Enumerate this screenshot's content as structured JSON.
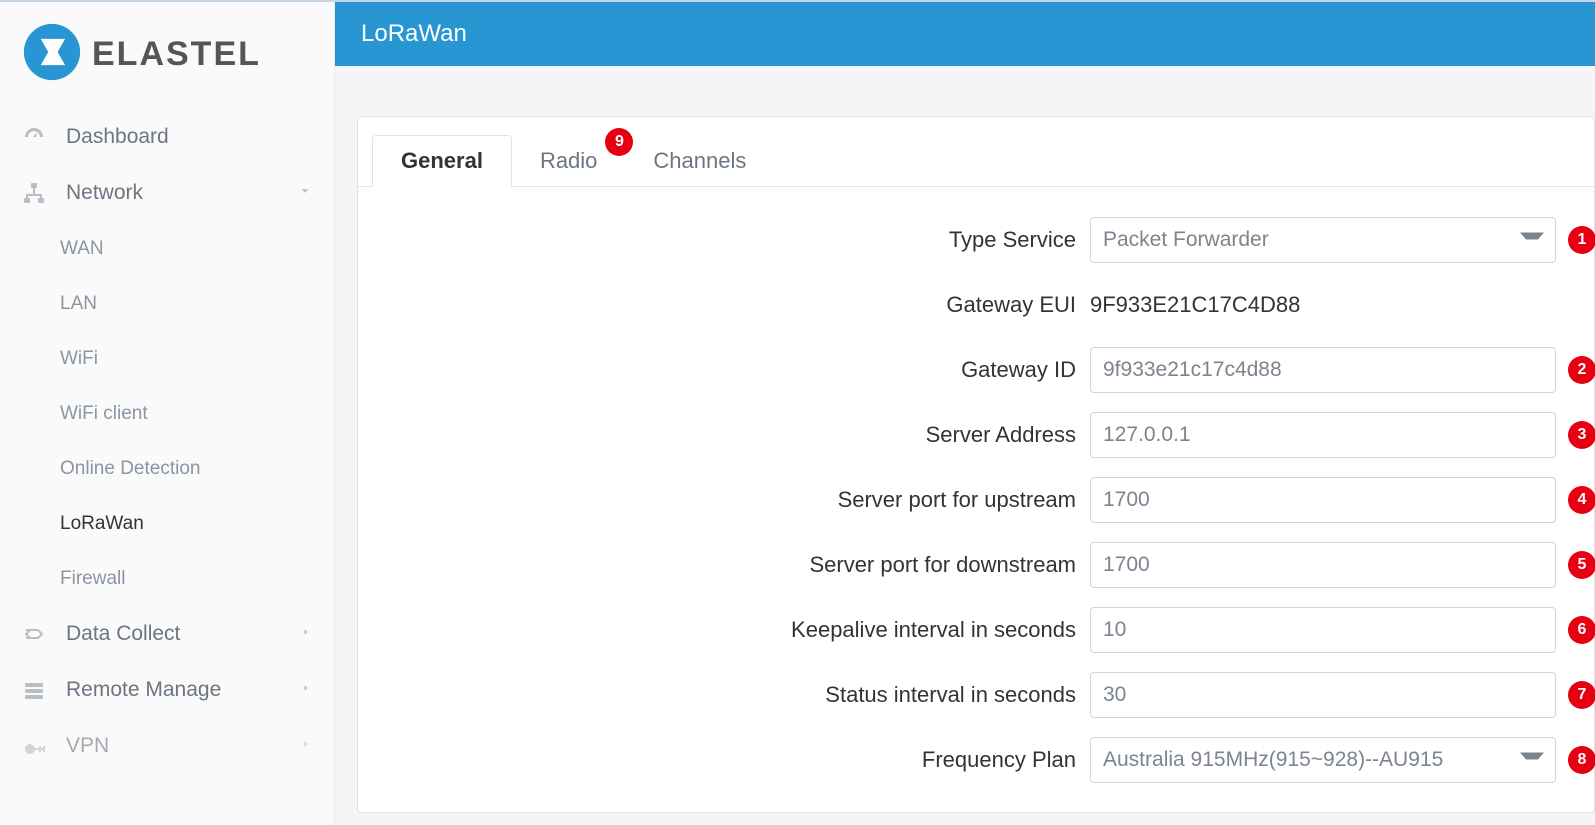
{
  "brand": "ELASTEL",
  "header": {
    "title": "LoRaWan"
  },
  "sidebar": {
    "items": [
      {
        "label": "Dashboard",
        "icon": "dashboard"
      },
      {
        "label": "Network",
        "icon": "network",
        "expanded": true,
        "children": [
          {
            "label": "WAN"
          },
          {
            "label": "LAN"
          },
          {
            "label": "WiFi"
          },
          {
            "label": "WiFi client"
          },
          {
            "label": "Online Detection"
          },
          {
            "label": "LoRaWan",
            "active": true
          },
          {
            "label": "Firewall"
          }
        ]
      },
      {
        "label": "Data Collect",
        "icon": "datacollect"
      },
      {
        "label": "Remote Manage",
        "icon": "remotemanage"
      },
      {
        "label": "VPN",
        "icon": "vpn"
      }
    ]
  },
  "tabs": [
    {
      "label": "General",
      "active": true
    },
    {
      "label": "Radio",
      "badge": "9"
    },
    {
      "label": "Channels"
    }
  ],
  "form": {
    "type_service": {
      "label": "Type Service",
      "value": "Packet Forwarder",
      "annotation": "1"
    },
    "gateway_eui": {
      "label": "Gateway EUI",
      "value": "9F933E21C17C4D88"
    },
    "gateway_id": {
      "label": "Gateway ID",
      "value": "9f933e21c17c4d88",
      "annotation": "2"
    },
    "server_address": {
      "label": "Server Address",
      "value": "127.0.0.1",
      "annotation": "3"
    },
    "port_upstream": {
      "label": "Server port for upstream",
      "value": "1700",
      "annotation": "4"
    },
    "port_downstream": {
      "label": "Server port for downstream",
      "value": "1700",
      "annotation": "5"
    },
    "keepalive": {
      "label": "Keepalive interval in seconds",
      "value": "10",
      "annotation": "6"
    },
    "status_interval": {
      "label": "Status interval in seconds",
      "value": "30",
      "annotation": "7"
    },
    "frequency_plan": {
      "label": "Frequency Plan",
      "value": "Australia 915MHz(915~928)--AU915",
      "annotation": "8"
    }
  }
}
